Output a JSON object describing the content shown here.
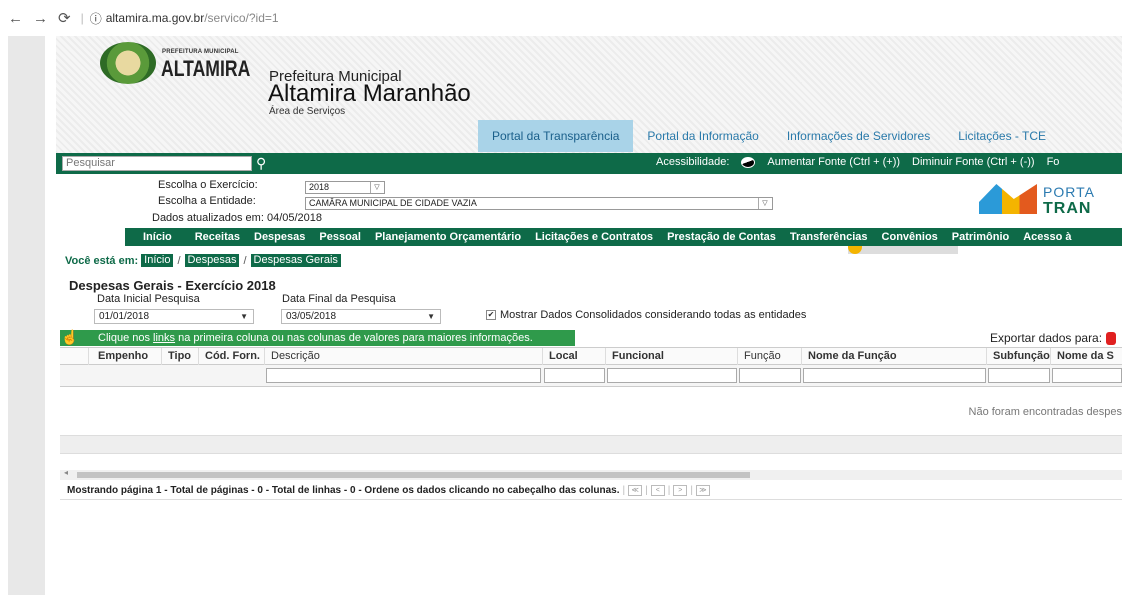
{
  "browser": {
    "url_host": "altamira.ma.gov.br",
    "url_path": "/servico/?id=1"
  },
  "header": {
    "logo_small": "PREFEITURA MUNICIPAL",
    "logo_big": "ALTAMIRA",
    "pm_small": "Prefeitura Municipal",
    "pm_big": "Altamira Maranhão",
    "pm_area": "Área de Serviços",
    "tabs": [
      {
        "label": "Portal da Transparência"
      },
      {
        "label": "Portal da Informação"
      },
      {
        "label": "Informações de Servidores"
      },
      {
        "label": "Licitações - TCE"
      }
    ]
  },
  "toolbar": {
    "search_placeholder": "Pesquisar",
    "accessibility": "Acessibilidade:",
    "increase_font": "Aumentar Fonte (Ctrl + (+))",
    "decrease_font": "Diminuir Fonte (Ctrl + (-))",
    "cut": "Fo"
  },
  "filters": {
    "exercicio_label": "Escolha o Exercício:",
    "exercicio_value": "2018",
    "entidade_label": "Escolha a Entidade:",
    "entidade_value": "CAMÂRA MUNICIPAL DE CIDADE VAZIA",
    "updated": "Dados atualizados em: 04/05/2018",
    "portal_logo_t1": "PORTA",
    "portal_logo_t2": "TRAN"
  },
  "menu": [
    "Início",
    "Receitas",
    "Despesas",
    "Pessoal",
    "Planejamento Orçamentário",
    "Licitações e Contratos",
    "Prestação de Contas",
    "Transferências",
    "Convênios",
    "Patrimônio",
    "Acesso à"
  ],
  "breadcrumb": {
    "prefix": "Você está em:",
    "items": [
      "Início",
      "Despesas",
      "Despesas Gerais"
    ]
  },
  "content": {
    "title": "Despesas Gerais - Exercício 2018",
    "data_inicial_label": "Data Inicial Pesquisa",
    "data_inicial_value": "01/01/2018",
    "data_final_label": "Data Final da Pesquisa",
    "data_final_value": "03/05/2018",
    "consolidado_label": "Mostrar Dados Consolidados considerando todas as entidades",
    "info_pre": "Clique nos ",
    "info_link": "links",
    "info_post": " na primeira coluna ou nas colunas de valores para maiores informações.",
    "export_label": "Exportar dados para:"
  },
  "grid": {
    "columns": [
      "Empenho",
      "Tipo",
      "Cód. Forn.",
      "Descrição",
      "Local",
      "Funcional",
      "Função",
      "Nome da Função",
      "Subfunção",
      "Nome da S"
    ],
    "empty_message": "Não foram encontradas despes"
  },
  "pager": {
    "text": "Mostrando página 1 - Total de páginas - 0 - Total de linhas - 0 - Ordene os dados clicando no cabeçalho das colunas."
  }
}
